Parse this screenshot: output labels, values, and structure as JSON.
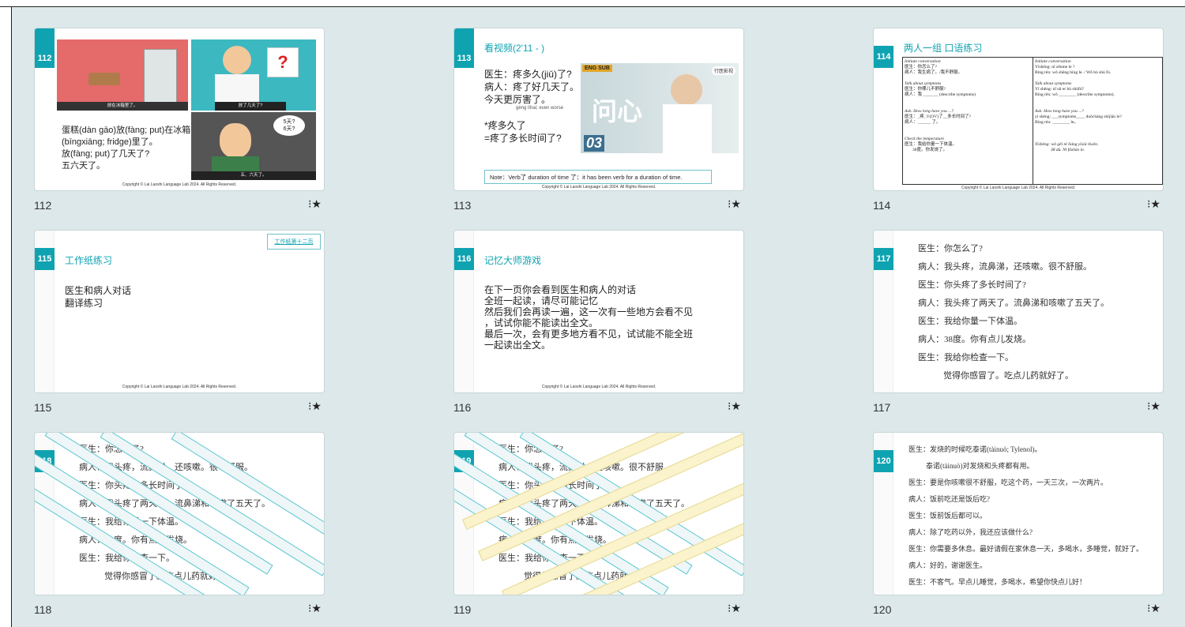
{
  "slides": [
    {
      "number": "112",
      "label": "112",
      "lines": [
        "蛋糕(dàn gāo)放(fàng; put)在冰箱",
        "(bīngxiāng; fridge)里了。",
        "放(fàng; put)了几天了?",
        "五六天了。"
      ],
      "captions": [
        "放在冰箱里了。",
        "放了几天了?",
        "五、六天了。"
      ],
      "bubble": [
        "5天?",
        "6天?"
      ],
      "copyright": "Copyright © Lai Laoshi Language Lab 2024. All Rights Reserved."
    },
    {
      "number": "113",
      "label": "113",
      "title": "看视频(2'11 - )",
      "lines": [
        "医生：疼多久(jiǔ)了?",
        "病人：疼了好几天了。",
        "今天更厉害了。",
        "gèng lìhai; even worse",
        "*疼多久了",
        "=疼了多长时间了?"
      ],
      "video": {
        "tag": "ENG SUB",
        "title": "问心",
        "ep": "03",
        "corner": "行医影视"
      },
      "note": "Note：Verb了 duration of time 了：it has been verb for a duration of time.",
      "copyright": "Copyright © Lai Laoshi Language Lab 2024. All Rights Reserved."
    },
    {
      "number": "114",
      "label": "114",
      "title": "两人一组 口语练习",
      "left_col": [
        "Initiate conversation",
        "医生：你怎么了?",
        "病人：我生病了。/我不舒服。",
        "",
        "Talk about symptoms",
        "医生：你哪儿不舒服?",
        "病人：我 _______ (describe symptoms)",
        "",
        "Ask: How long have you ...?",
        "医生：_疼_V(OV)了__多长时间了?",
        "病人：______ 了。",
        "",
        "Check the temperature",
        "医生：我给你量一下体温。",
        "38度。你发烧了。"
      ],
      "right_col": [
        "Initiate conversation",
        "Yīshēng: nǐ zěnme le ?",
        "Bìng rén: wǒ shēng bìng le. / Wǒ bù shū fú.",
        "",
        "Talk about symptoms",
        "Yī shēng: nǐ nǎ er bù shūfú?",
        "Bìng rén: wǒ ________ (describe symptoms).",
        "",
        "Ask: How long have you ...?",
        "yī shēng: ___symptoms____ duōcháng shíjiān le?",
        "Bìng rén: ________ le。",
        "",
        "Yīshēng: wǒ gěi nǐ liáng yīxià tǐwēn.",
        "38 dù. Nǐ fāshāo le."
      ],
      "copyright": "Copyright © Lai Laoshi Language Lab 2024. All Rights Reserved."
    },
    {
      "number": "115",
      "label": "115",
      "title": "工作纸练习",
      "link": "工作纸第十二页",
      "lines": [
        "医生和病人对话",
        "翻译练习"
      ],
      "copyright": "Copyright © Lai Laoshi Language Lab 2024. All Rights Reserved."
    },
    {
      "number": "116",
      "label": "116",
      "title": "记忆大师游戏",
      "lines": [
        "在下一页你会看到医生和病人的对话",
        "全班一起读，请尽可能记忆",
        "然后我们会再读一遍，这一次有一些地方会看不见",
        "，试试你能不能读出全文。",
        "最后一次，会有更多地方看不见，试试能不能全班",
        "一起读出全文。"
      ],
      "copyright": "Copyright © Lai Laoshi Language Lab 2024. All Rights Reserved."
    },
    {
      "number": "117",
      "label": "117",
      "dialogue": [
        "医生：你怎么了?",
        "病人：我头疼，流鼻涕，还咳嗽。很不舒服。",
        "医生：你头疼了多长时间了?",
        "病人：我头疼了两天了。流鼻涕和咳嗽了五天了。",
        "医生：我给你量一下体温。",
        "病人：38度。你有点儿发烧。",
        "医生：我给你检查一下。",
        "觉得你感冒了。吃点儿药就好了。"
      ]
    },
    {
      "number": "118",
      "label": "118",
      "dialogue": [
        "医生：你怎么了?",
        "病人：我头疼，流鼻涕，还咳嗽。很不舒服。",
        "医生：你头疼了多长时间了?",
        "病人：我头疼了两天了。流鼻涕和咳嗽了五天了。",
        "医生：我给你量一下体温。",
        "病人：38度。你有点儿发烧。",
        "医生：我给你检查一下。",
        "觉得你感冒了。吃点儿药就好了。"
      ]
    },
    {
      "number": "119",
      "label": "119",
      "dialogue": [
        "医生：你怎么了?",
        "病人：我头疼，流鼻涕，还咳嗽。很不舒服。",
        "医生：你头疼了多长时间了?",
        "病人：我头疼了两天了。流鼻涕和咳嗽了五天了。",
        "医生：我给你量一下体温。",
        "病人：38度。你有点儿发烧。",
        "医生：我给你检查一下。",
        "觉得你感冒了。吃点儿药就好了。"
      ]
    },
    {
      "number": "120",
      "label": "120",
      "dialogue": [
        "医生：发烧的时候吃泰诺(tàinuò; Tylenol)。",
        "泰诺(tàinuò)对发烧和头疼都有用。",
        "医生：要是你咳嗽很不舒服，吃这个药，一天三次，一次两片。",
        "病人：饭前吃还是饭后吃?",
        "医生：饭前饭后都可以。",
        "病人：除了吃药以外，我还应该做什么?",
        "医生：你需要多休息。最好请假在家休息一天，多喝水，多睡觉，就好了。",
        "病人：好的，谢谢医生。",
        "医生：不客气。早点儿睡觉，多喝水，希望你快点儿好！"
      ]
    }
  ],
  "star_icon": "star-icon",
  "accent": "#0fa3b1",
  "highlight": "#fff200"
}
